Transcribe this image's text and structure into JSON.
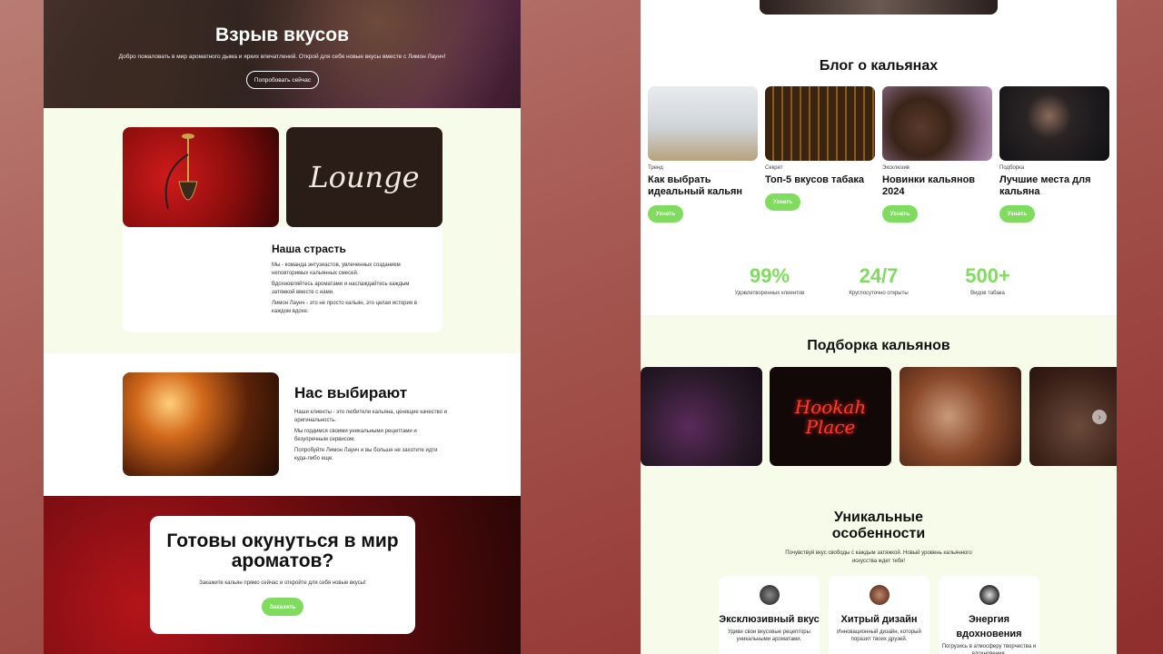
{
  "left": {
    "hero": {
      "title": "Взрыв вкусов",
      "subtitle": "Добро пожаловать в мир ароматного дыма и ярких впечатлений. Открой для себя новые вкусы вместе с Лимон Лаунч!",
      "button": "Попробовать сейчас"
    },
    "passion": {
      "image_text": "Lounge",
      "title": "Наша страсть",
      "paragraphs": [
        "Мы - команда энтузиастов, увлеченных созданием неповторимых кальянных смесей.",
        "Вдохновляйтесь ароматами и наслаждайтесь каждым затяжкой вместе с нами.",
        "Лимон Лаунч - это не просто кальян, это целая история в каждом вдохе."
      ]
    },
    "choose": {
      "title": "Нас выбирают",
      "paragraphs": [
        "Наши клиенты - это любители кальяна, ценящие качество и оригинальность.",
        "Мы гордимся своими уникальными рецептами и безупречным сервисом.",
        "Попробуйте Лимон Лаунч и вы больше не захотите идти куда-либо еще."
      ]
    },
    "cta": {
      "title": "Готовы окунуться в мир ароматов?",
      "subtitle": "Закажите кальян прямо сейчас и откройте для себя новые вкусы!",
      "button": "Заказать"
    }
  },
  "right": {
    "blog": {
      "title": "Блог о кальянах",
      "cards": [
        {
          "tag": "Тренд",
          "title": "Как выбрать идеальный кальян",
          "button": "Узнать"
        },
        {
          "tag": "Секрет",
          "title": "Топ-5 вкусов табака",
          "button": "Узнать"
        },
        {
          "tag": "Эксклюзив",
          "title": "Новинки кальянов 2024",
          "button": "Узнать"
        },
        {
          "tag": "Подборка",
          "title": "Лучшие места для кальяна",
          "button": "Узнать"
        }
      ]
    },
    "stats": [
      {
        "value": "99%",
        "label": "Удовлетворенных клиентов"
      },
      {
        "value": "24/7",
        "label": "Круглосуточно открыты"
      },
      {
        "value": "500+",
        "label": "Видов табака"
      }
    ],
    "collection": {
      "title": "Подборка кальянов",
      "neon_line1": "Hookah",
      "neon_line2": "Place",
      "arrow": "›"
    },
    "unique": {
      "title_line1": "Уникальные",
      "title_line2": "особенности",
      "subtitle": "Почувствуй вкус свободы с каждым затяжкой. Новый уровень кальянного искусства ждет тебя!",
      "features": [
        {
          "title": "Эксклюзивный вкус",
          "text": "Удиви свои вкусовые рецепторы уникальными ароматами."
        },
        {
          "title": "Хитрый дизайн",
          "text": "Инновационный дизайн, который поразит твоих друзей."
        },
        {
          "title": "Энергия вдохновения",
          "text": "Погрузись в атмосферу творчества и вдохновения."
        }
      ]
    }
  },
  "colors": {
    "accent_green": "#7fdc5f",
    "section_cream": "#f7fbe9",
    "background_red": "#8f2e2c"
  }
}
